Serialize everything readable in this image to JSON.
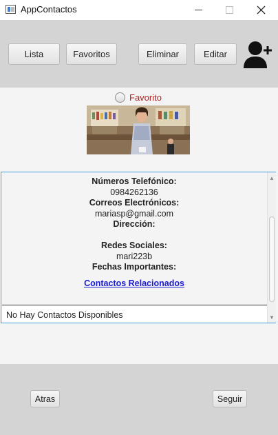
{
  "window": {
    "title": "AppContactos"
  },
  "toolbar": {
    "lista_label": "Lista",
    "favoritos_label": "Favoritos",
    "eliminar_label": "Eliminar",
    "editar_label": "Editar"
  },
  "contact": {
    "favorito_label": "Favorito",
    "favorito_checked": false,
    "details": {
      "telefonos_label": "Números Telefónico:",
      "telefono": "0984262136",
      "correos_label": "Correos Electrónicos:",
      "correo": "mariasp@gmail.com",
      "direccion_label": "Dirección:",
      "redes_label": "Redes Sociales:",
      "red": "mari223b",
      "fechas_label": "Fechas Importantes:",
      "relacionados_link": "Contactos Relacionados "
    },
    "no_contacts": "No Hay Contactos Disponibles"
  },
  "navigation": {
    "atras_label": "Atras",
    "seguir_label": "Seguir"
  },
  "colors": {
    "toolbar_bg": "#d4d4d4",
    "favorito_text": "#b22222",
    "link": "#1a1ad0",
    "focus_border": "#3aa0d8"
  }
}
